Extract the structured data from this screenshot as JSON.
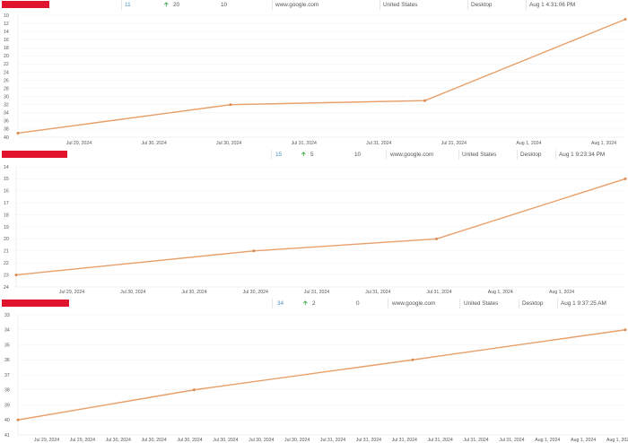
{
  "colors": {
    "line": "#e8a06a",
    "marker": "#d98a52",
    "redbar": "#e0142c",
    "up_arrow": "#3aa845",
    "rank_text": "#4a8fc0"
  },
  "rows": [
    {
      "rank": "11",
      "change": "20",
      "change_icon": "arrow-up-icon",
      "prev": "10",
      "url": "www.google.com",
      "country": "United States",
      "device": "Desktop",
      "date": "Aug 1 4:31:06 PM",
      "chart_data": {
        "type": "line",
        "y_ticks": [
          "10",
          "12",
          "14",
          "16",
          "18",
          "20",
          "22",
          "24",
          "26",
          "28",
          "30",
          "32",
          "34",
          "36",
          "38",
          "40"
        ],
        "ylim": [
          10,
          40
        ],
        "y_inverted": true,
        "x_ticks": [
          "Jul 29, 2024",
          "Jul 30, 2024",
          "Jul 30, 2024",
          "Jul 31, 2024",
          "Jul 31, 2024",
          "Jul 31, 2024",
          "Aug 1, 2024",
          "Aug 1, 2024"
        ],
        "xlim": [
          0,
          1
        ],
        "x": [
          0.0,
          0.35,
          0.67,
          1.0
        ],
        "values": [
          39,
          32,
          31,
          11
        ]
      }
    },
    {
      "rank": "15",
      "change": "5",
      "change_icon": "arrow-up-icon",
      "prev": "10",
      "url": "www.google.com",
      "country": "United States",
      "device": "Desktop",
      "date": "Aug 1 9:23:34 PM",
      "chart_data": {
        "type": "line",
        "y_ticks": [
          "14",
          "15",
          "16",
          "17",
          "18",
          "19",
          "20",
          "21",
          "22",
          "23",
          "24"
        ],
        "ylim": [
          14,
          24
        ],
        "y_inverted": true,
        "x_ticks": [
          "Jul 29, 2024",
          "Jul 30, 2024",
          "Jul 30, 2024",
          "Jul 30, 2024",
          "Jul 31, 2024",
          "Jul 31, 2024",
          "Jul 31, 2024",
          "Aug 1, 2024",
          "Aug 1, 2024"
        ],
        "xlim": [
          0,
          1
        ],
        "x": [
          0.0,
          0.39,
          0.69,
          1.0
        ],
        "values": [
          23,
          21,
          20,
          15
        ]
      }
    },
    {
      "rank": "34",
      "change": "2",
      "change_icon": "arrow-up-icon",
      "prev": "0",
      "url": "www.google.com",
      "country": "United States",
      "device": "Desktop",
      "date": "Aug 1 9:37:25 AM",
      "chart_data": {
        "type": "line",
        "y_ticks": [
          "33",
          "34",
          "35",
          "36",
          "37",
          "38",
          "39",
          "40",
          "41"
        ],
        "ylim": [
          33,
          41
        ],
        "y_inverted": true,
        "x_ticks": [
          "Jul 29, 2024",
          "Jul 29, 2024",
          "Jul 30, 2024",
          "Jul 30, 2024",
          "Jul 30, 2024",
          "Jul 30, 2024",
          "Jul 30, 2024",
          "Jul 30, 2024",
          "Jul 31, 2024",
          "Jul 31, 2024",
          "Jul 31, 2024",
          "Jul 31, 2024",
          "Jul 31, 2024",
          "Jul 31, 2024",
          "Aug 1, 2024",
          "Aug 1, 2024",
          "Aug 1, 2024"
        ],
        "xlim": [
          0,
          1
        ],
        "x": [
          0.0,
          0.29,
          0.65,
          1.0
        ],
        "values": [
          40,
          38,
          36,
          34
        ]
      }
    }
  ]
}
